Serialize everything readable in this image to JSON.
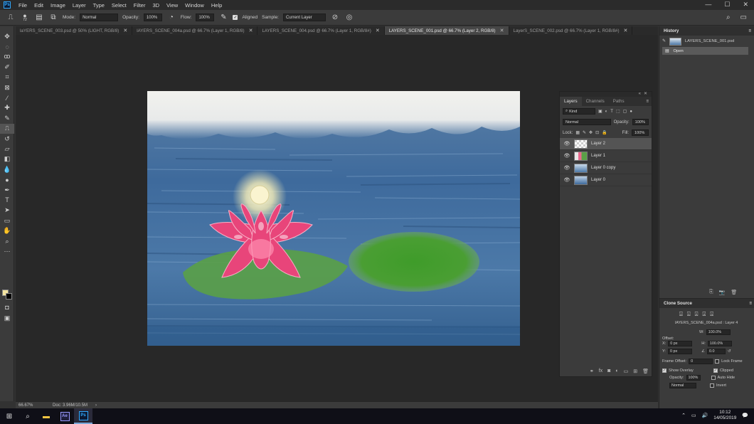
{
  "app": {
    "logo": "Ps"
  },
  "menu": [
    "File",
    "Edit",
    "Image",
    "Layer",
    "Type",
    "Select",
    "Filter",
    "3D",
    "View",
    "Window",
    "Help"
  ],
  "window_controls": {
    "minimize": "—",
    "maximize": "☐",
    "close": "✕"
  },
  "options_bar": {
    "brush_size": "72",
    "mode_label": "Mode:",
    "mode_value": "Normal",
    "opacity_label": "Opacity:",
    "opacity_value": "100%",
    "flow_label": "Flow:",
    "flow_value": "100%",
    "aligned_label": "Aligned",
    "sample_label": "Sample:",
    "sample_value": "Current Layer"
  },
  "tabs": [
    {
      "label": "laYERS_SCENE_003.psd @ 50% (LIGHT, RGB/8)",
      "active": false
    },
    {
      "label": "lAYERS_SCENE_004a.psd @ 66.7% (Layer 1, RGB/8)",
      "active": false
    },
    {
      "label": "LAYERS_SCENE_004.psd @ 66.7% (Layer 1, RGB/8#)",
      "active": false
    },
    {
      "label": "LAYERS_SCENE_001.psd @ 66.7% (Layer 2, RGB/8)",
      "active": true
    },
    {
      "label": "LayerS_SCENE_002.psd @ 66.7% (Layer 1, RGB/8#)",
      "active": false
    }
  ],
  "status": {
    "zoom": "66.67%",
    "doc": "Doc: 3.96M/10.5M",
    "arrow": "›"
  },
  "layers_panel": {
    "tabs": [
      "Layers",
      "Channels",
      "Paths"
    ],
    "kind_label": "Kind",
    "blend_mode": "Normal",
    "opacity_label": "Opacity:",
    "opacity_value": "100%",
    "lock_label": "Lock:",
    "fill_label": "Fill:",
    "fill_value": "100%",
    "layers": [
      {
        "name": "Layer 2",
        "selected": true
      },
      {
        "name": "Layer 1",
        "selected": false
      },
      {
        "name": "Layer 0 copy",
        "selected": false
      },
      {
        "name": "Layer 0",
        "selected": false
      }
    ]
  },
  "history": {
    "title": "History",
    "snapshot": "LAYERS_SCENE_001.psd",
    "state": "Open"
  },
  "clone_source": {
    "title": "Clone Source",
    "source_name": "lAYERS_SCENE_004a.psd : Layer 4",
    "offset_label": "Offset:",
    "x_label": "X:",
    "x_value": "0 px",
    "y_label": "Y:",
    "y_value": "0 px",
    "w_label": "W:",
    "w_value": "100.0%",
    "h_label": "H:",
    "h_value": "100.0%",
    "angle_value": "0.0",
    "frame_offset_label": "Frame Offset:",
    "frame_offset_value": "0",
    "lock_frame": "Lock Frame",
    "show_overlay": "Show Overlay",
    "clipped": "Clipped",
    "opacity_label": "Opacity:",
    "opacity_value": "100%",
    "auto_hide": "Auto Hide",
    "mode_value": "Normal",
    "invert": "Invert"
  },
  "taskbar": {
    "time": "10:12",
    "date": "14/05/2019",
    "apps": [
      "Ae",
      "Ps"
    ]
  },
  "colors": {
    "foreground": "#f3e4a0",
    "background": "#000000",
    "accent": "#31a8ff"
  }
}
